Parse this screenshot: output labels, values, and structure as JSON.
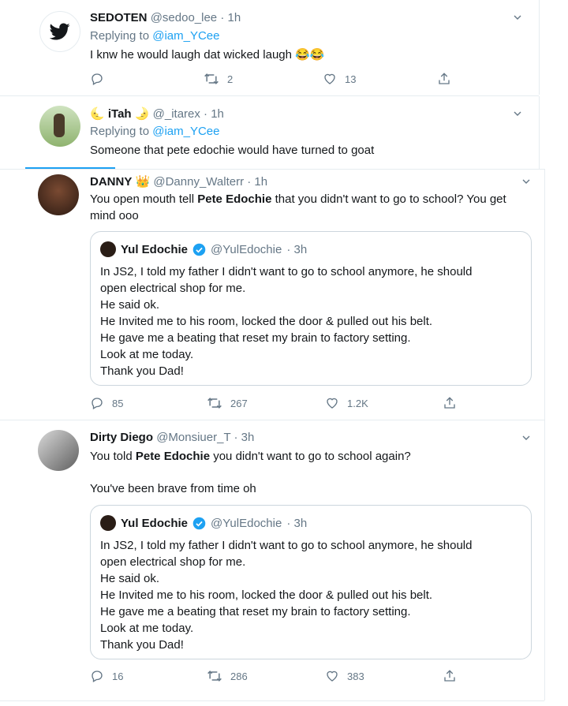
{
  "tweets": [
    {
      "name": "SEDOTEN",
      "handle": "@sedoo_lee",
      "time": "· 1h",
      "replying_label": "Replying to",
      "replying_to": "@iam_YCee",
      "text": "I knw he would laugh dat wicked laugh 😂😂",
      "retweets": "2",
      "likes": "13"
    },
    {
      "name": "iTah",
      "name_prefix": "🌜",
      "name_suffix": "🌛",
      "handle": "@_itarex",
      "time": "· 1h",
      "replying_label": "Replying to",
      "replying_to": "@iam_YCee",
      "text": "Someone that pete edochie would have turned to goat"
    },
    {
      "name": "DANNY",
      "name_suffix": "👑",
      "handle": "@Danny_Walterr",
      "time": "· 1h",
      "text_before": "You open mouth tell ",
      "text_bold": "Pete Edochie",
      "text_after": " that you didn't want to go to school? You get mind ooo",
      "quote": {
        "name": "Yul Edochie",
        "handle": "@YulEdochie",
        "time": "· 3h",
        "lines": [
          "In JS2, I told my father I didn't want to go to school anymore, he should",
          "open electrical shop for me.",
          "He said ok.",
          "He Invited me to his room, locked the door & pulled out his belt.",
          "He gave me a beating that reset my brain to factory setting.",
          "Look at me today.",
          "Thank you Dad!"
        ]
      },
      "replies": "85",
      "retweets": "267",
      "likes": "1.2K"
    },
    {
      "name": "Dirty Diego",
      "handle": "@Monsiuer_T",
      "time": "· 3h",
      "text_before": "You told ",
      "text_bold": "Pete Edochie",
      "text_after": " you didn't want to go to school again?",
      "text2": "You've been brave from time oh",
      "quote": {
        "name": "Yul Edochie",
        "handle": "@YulEdochie",
        "time": "· 3h",
        "lines": [
          "In JS2, I told my father I didn't want to go to school anymore, he should",
          "open electrical shop for me.",
          "He said ok.",
          "He Invited me to his room, locked the door & pulled out his belt.",
          "He gave me a beating that reset my brain to factory setting.",
          "Look at me today.",
          "Thank you Dad!"
        ]
      },
      "replies": "16",
      "retweets": "286",
      "likes": "383"
    }
  ],
  "colors": {
    "accent": "#1da1f2",
    "muted": "#657786",
    "border": "#ccd6dd"
  },
  "icons": [
    "twitter-bird-icon",
    "chevron-down-icon",
    "reply-icon",
    "retweet-icon",
    "like-icon",
    "share-icon",
    "verified-icon"
  ]
}
